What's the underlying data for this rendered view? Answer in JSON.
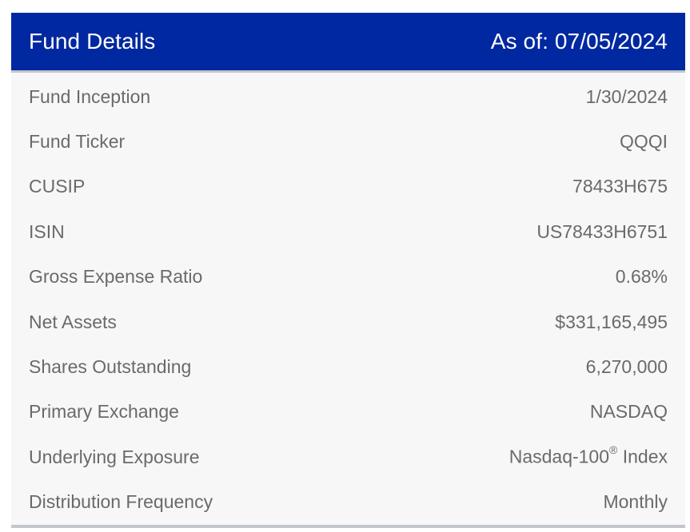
{
  "header": {
    "title": "Fund Details",
    "as_of": "As of: 07/05/2024"
  },
  "rows": [
    {
      "label": "Fund Inception",
      "value": "1/30/2024"
    },
    {
      "label": "Fund Ticker",
      "value": "QQQI"
    },
    {
      "label": "CUSIP",
      "value": "78433H675"
    },
    {
      "label": "ISIN",
      "value": "US78433H6751"
    },
    {
      "label": "Gross Expense Ratio",
      "value": "0.68%"
    },
    {
      "label": "Net Assets",
      "value": "$331,165,495"
    },
    {
      "label": "Shares Outstanding",
      "value": "6,270,000"
    },
    {
      "label": "Primary Exchange",
      "value": "NASDAQ"
    },
    {
      "label": "Underlying Exposure",
      "value_prefix": "Nasdaq-100",
      "value_sup": "®",
      "value_suffix": " Index"
    },
    {
      "label": "Distribution Frequency",
      "value": "Monthly"
    }
  ],
  "colors": {
    "header_bg": "#0028a0",
    "header_text": "#ffffff",
    "row_bg": "#f7f7f7",
    "row_text": "#6a6a6a",
    "divider": "#c3c6cc"
  }
}
